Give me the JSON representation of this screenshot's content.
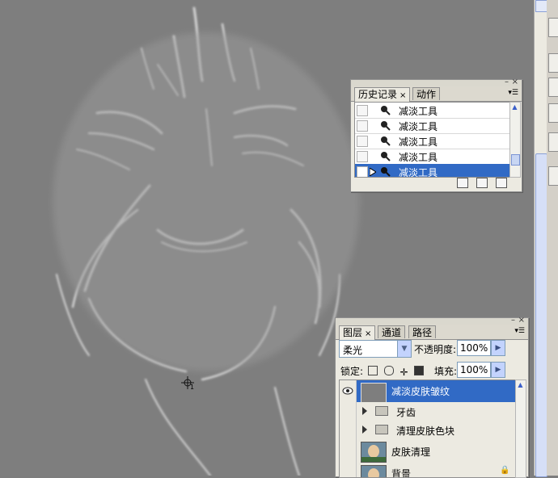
{
  "history": {
    "tabs": [
      {
        "label": "历史记录",
        "close": "×"
      },
      {
        "label": "动作"
      }
    ],
    "items": [
      {
        "label": "减淡工具"
      },
      {
        "label": "减淡工具"
      },
      {
        "label": "减淡工具"
      },
      {
        "label": "减淡工具"
      },
      {
        "label": "减淡工具",
        "selected": true
      }
    ],
    "item_icon": "dodge-tool-icon",
    "footer_icons": [
      "new-document-icon",
      "camera-icon",
      "trash-icon"
    ]
  },
  "layers": {
    "tabs": [
      {
        "label": "图层",
        "close": "×"
      },
      {
        "label": "通道"
      },
      {
        "label": "路径"
      }
    ],
    "blend_mode": "柔光",
    "opacity_label": "不透明度:",
    "opacity_value": "100%",
    "lock_label": "锁定:",
    "fill_label": "填充:",
    "fill_value": "100%",
    "items": [
      {
        "name": "减淡皮肤皱纹",
        "type": "layer",
        "visible": true,
        "selected": true
      },
      {
        "name": "牙齿",
        "type": "group"
      },
      {
        "name": "清理皮肤色块",
        "type": "group"
      },
      {
        "name": "皮肤清理",
        "type": "layer"
      },
      {
        "name": "背景",
        "type": "layer",
        "locked": true
      }
    ]
  },
  "canvas": {
    "background_color": "#7e7e7e",
    "cursor_label": "1"
  },
  "window_controls": {
    "minimize": "–",
    "close": "×"
  }
}
